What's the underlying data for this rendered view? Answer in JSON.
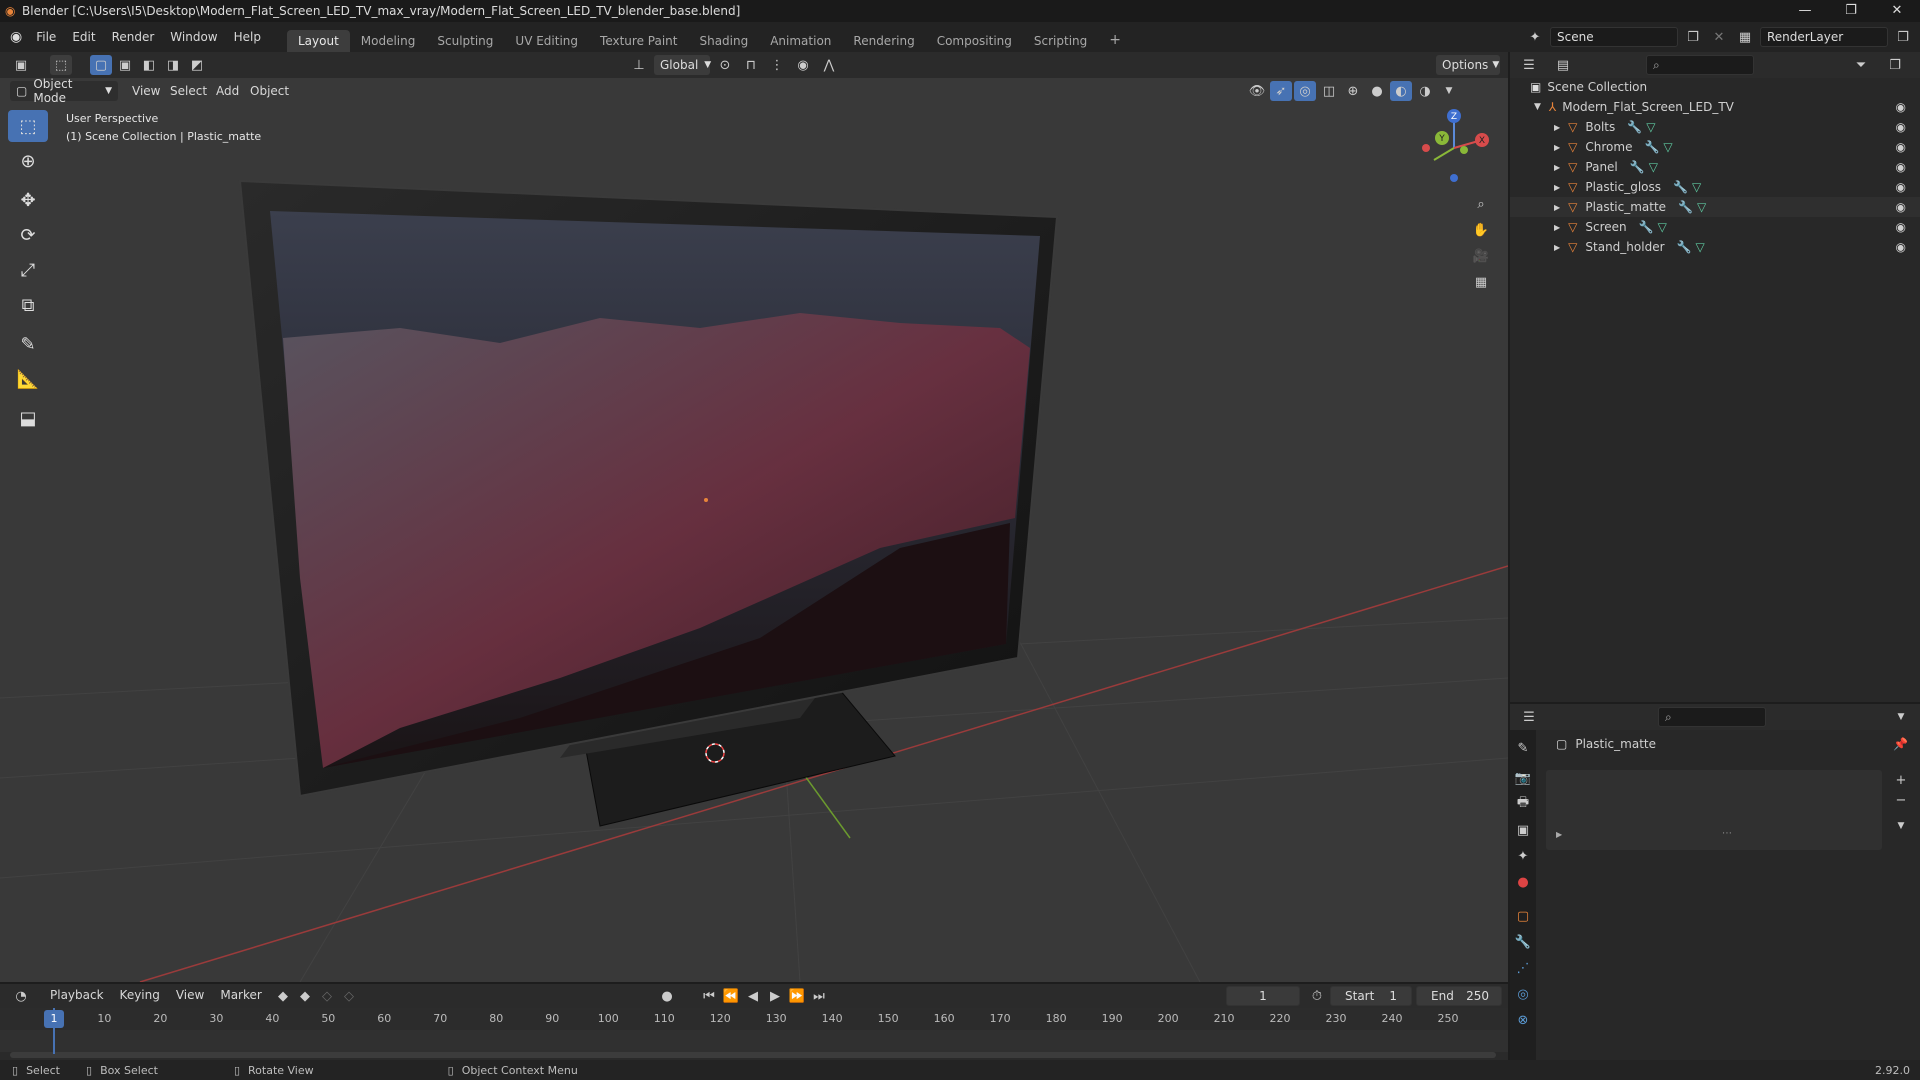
{
  "window": {
    "title": "Blender [C:\\Users\\I5\\Desktop\\Modern_Flat_Screen_LED_TV_max_vray/Modern_Flat_Screen_LED_TV_blender_base.blend]"
  },
  "menus": [
    "File",
    "Edit",
    "Render",
    "Window",
    "Help"
  ],
  "workspaces": [
    "Layout",
    "Modeling",
    "Sculpting",
    "UV Editing",
    "Texture Paint",
    "Shading",
    "Animation",
    "Rendering",
    "Compositing",
    "Scripting"
  ],
  "active_workspace": "Layout",
  "scene": {
    "name": "Scene",
    "view_layer": "RenderLayer"
  },
  "viewport_header": {
    "transform_orientation": "Global",
    "options_label": "Options",
    "mode": "Object Mode",
    "menus": [
      "View",
      "Select",
      "Add",
      "Object"
    ]
  },
  "viewport": {
    "perspective_label": "User Perspective",
    "context_label": "(1) Scene Collection | Plastic_matte",
    "gizmo_axes": {
      "z": "Z",
      "y": "Y",
      "x": "X"
    }
  },
  "outliner": {
    "root": "Scene Collection",
    "collection": "Modern_Flat_Screen_LED_TV",
    "objects": [
      "Bolts",
      "Chrome",
      "Panel",
      "Plastic_gloss",
      "Plastic_matte",
      "Screen",
      "Stand_holder"
    ],
    "selected": "Plastic_matte"
  },
  "properties": {
    "object_name": "Plastic_matte"
  },
  "timeline": {
    "menus": [
      "Playback",
      "Keying",
      "View",
      "Marker"
    ],
    "current_frame": "1",
    "start_label": "Start",
    "start": "1",
    "end_label": "End",
    "end": "250",
    "ticks": [
      "1",
      "10",
      "20",
      "30",
      "40",
      "50",
      "60",
      "70",
      "80",
      "90",
      "100",
      "110",
      "120",
      "130",
      "140",
      "150",
      "160",
      "170",
      "180",
      "190",
      "200",
      "210",
      "220",
      "230",
      "240",
      "250"
    ]
  },
  "statusbar": {
    "select": "Select",
    "box_select": "Box Select",
    "rotate_view": "Rotate View",
    "context_menu": "Object Context Menu",
    "version": "2.92.0"
  },
  "colors": {
    "accent": "#4772b3",
    "object_icon": "#e8843a",
    "mesh_icon": "#5fc8a0"
  }
}
